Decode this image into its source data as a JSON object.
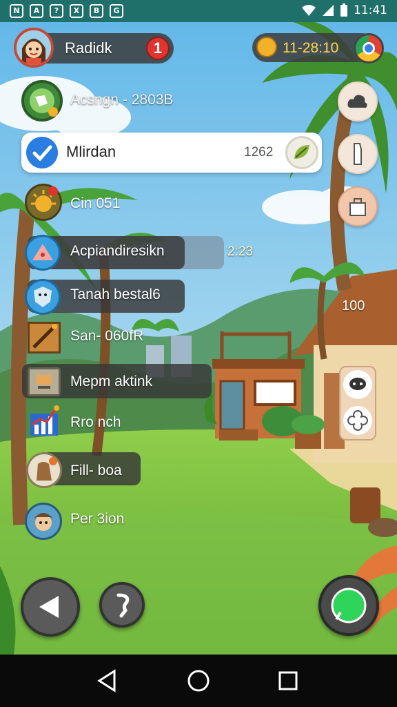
{
  "status_bar": {
    "left_icons": [
      "N",
      "A",
      "?",
      "X",
      "B",
      "G"
    ],
    "time": "11:41"
  },
  "player": {
    "name": "Radidk",
    "alert_badge": "1"
  },
  "currency": {
    "value": "11-28:10"
  },
  "list_items": [
    {
      "label": "Acsngn - 2803B",
      "value": "",
      "icon": "globe-icon"
    },
    {
      "label": "Mlirdan",
      "value": "1262",
      "icon": "checkmark-icon",
      "highlighted": true
    },
    {
      "label": "Cin 051",
      "value": "",
      "icon": "sun-icon"
    },
    {
      "label": "Acpiandiresikn",
      "value": "2:23",
      "icon": "warning-icon"
    },
    {
      "label": "Tanah bestal6",
      "value": "",
      "icon": "shield-icon"
    },
    {
      "label": "San- 060fR",
      "value": "",
      "icon": "hammer-icon"
    },
    {
      "label": "Mepm aktink",
      "value": "",
      "icon": "card-icon"
    },
    {
      "label": "Rro nch",
      "value": "",
      "icon": "chart-icon"
    },
    {
      "label": "Fill- boa",
      "value": "",
      "icon": "sack-icon"
    },
    {
      "label": "Per 3ion",
      "value": "",
      "icon": "profile-icon"
    }
  ],
  "side_buttons": [
    "cloud-icon",
    "bottle-icon",
    "bag-icon"
  ],
  "house_label": "100",
  "house_side_buttons": [
    "chat-bubble-icon",
    "gear-flower-icon"
  ],
  "controls": {
    "left": "play-back-icon",
    "center": "info-icon",
    "right": "whatsapp-icon"
  },
  "nav_bar": [
    "back-triangle-icon",
    "home-circle-icon",
    "recent-square-icon"
  ]
}
